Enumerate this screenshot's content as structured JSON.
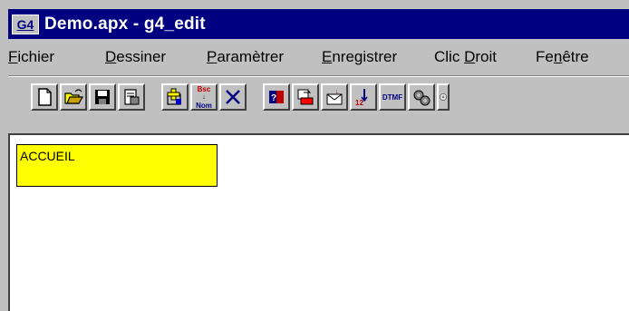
{
  "window": {
    "title": "Demo.apx - g4_edit",
    "app_icon_label": "G4"
  },
  "menu": [
    {
      "prefix": "",
      "accel": "F",
      "rest": "ichier"
    },
    {
      "prefix": "",
      "accel": "D",
      "rest": "essiner"
    },
    {
      "prefix": "",
      "accel": "P",
      "rest": "aramètrer"
    },
    {
      "prefix": "",
      "accel": "E",
      "rest": "nregistrer"
    },
    {
      "prefix": "Clic ",
      "accel": "D",
      "rest": "roit"
    },
    {
      "prefix": "Fe",
      "accel": "n",
      "rest": "être"
    }
  ],
  "toolbar": {
    "buttons": [
      {
        "icon": "new-document-icon"
      },
      {
        "icon": "open-folder-icon"
      },
      {
        "icon": "save-disk-icon"
      },
      {
        "icon": "properties-icon"
      },
      {
        "icon": "add-node-icon"
      },
      {
        "icon": "rename-node-icon",
        "text_top": "Bsc",
        "text_bottom": "Nom"
      },
      {
        "icon": "delete-icon"
      },
      {
        "icon": "book-icon"
      },
      {
        "icon": "phone-transfer-icon"
      },
      {
        "icon": "mail-icon"
      },
      {
        "icon": "number-input-icon",
        "text": "12"
      },
      {
        "icon": "dtmf-icon",
        "text": "DTMF"
      },
      {
        "icon": "settings-gears-icon"
      },
      {
        "icon": "disc-icon"
      }
    ]
  },
  "workspace": {
    "nodes": [
      {
        "label": "ACCUEIL",
        "color": "#ffff00"
      }
    ]
  },
  "colors": {
    "titlebar": "#000080",
    "chrome": "#c0c0c0",
    "node": "#ffff00"
  }
}
